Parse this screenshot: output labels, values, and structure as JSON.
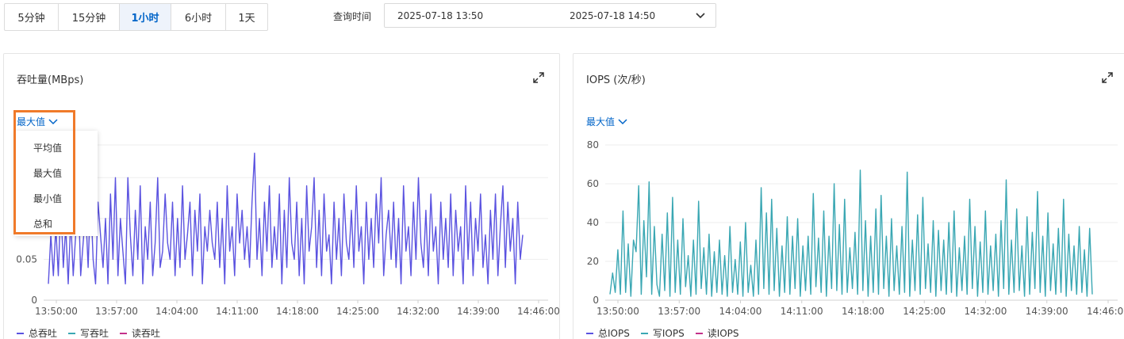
{
  "toolbar": {
    "ranges": [
      "5分钟",
      "15分钟",
      "1小时",
      "6小时",
      "1天"
    ],
    "active_index": 2
  },
  "query_time": {
    "label": "查询时间",
    "start": "2025-07-18 13:50",
    "end": "2025-07-18 14:50"
  },
  "colors": {
    "accent": "#0064c8",
    "throughput_line": "#5b53e0",
    "iops_line": "#3aa7b3",
    "legend_total": "#5b53e0",
    "legend_write": "#3aa7b3",
    "legend_read": "#c4318a",
    "highlight": "#f07a2a"
  },
  "throughput_panel": {
    "title": "吞吐量(MBps)",
    "aggregation": {
      "selected": "最大值",
      "options": [
        "平均值",
        "最大值",
        "最小值",
        "总和"
      ]
    },
    "legend": [
      "总吞吐",
      "写吞吐",
      "读吞吐"
    ]
  },
  "iops_panel": {
    "title": "IOPS (次/秒)",
    "aggregation": {
      "selected": "最大值"
    },
    "legend": [
      "总IOPS",
      "写IOPS",
      "读IOPS"
    ]
  },
  "chart_data": [
    {
      "type": "line",
      "title": "吞吐量(MBps)",
      "x_ticks": [
        "13:50:00",
        "13:57:00",
        "14:04:00",
        "14:11:00",
        "14:18:00",
        "14:25:00",
        "14:32:00",
        "14:39:00",
        "14:46:00"
      ],
      "y_ticks_visible": [
        "0.05",
        "0"
      ],
      "ylim": [
        0,
        0.19
      ],
      "series": [
        {
          "name": "总吞吐",
          "values": [
            0.02,
            0.08,
            0.03,
            0.09,
            0.03,
            0.12,
            0.04,
            0.09,
            0.02,
            0.1,
            0.03,
            0.08,
            0.14,
            0.03,
            0.07,
            0.11,
            0.04,
            0.13,
            0.05,
            0.02,
            0.12,
            0.08,
            0.04,
            0.1,
            0.02,
            0.13,
            0.05,
            0.15,
            0.03,
            0.1,
            0.06,
            0.02,
            0.15,
            0.08,
            0.03,
            0.11,
            0.05,
            0.14,
            0.02,
            0.09,
            0.05,
            0.12,
            0.03,
            0.07,
            0.15,
            0.04,
            0.06,
            0.13,
            0.07,
            0.05,
            0.12,
            0.03,
            0.1,
            0.04,
            0.14,
            0.05,
            0.08,
            0.12,
            0.03,
            0.11,
            0.06,
            0.13,
            0.02,
            0.09,
            0.06,
            0.11,
            0.07,
            0.05,
            0.12,
            0.04,
            0.1,
            0.02,
            0.14,
            0.06,
            0.09,
            0.03,
            0.13,
            0.07,
            0.11,
            0.05,
            0.09,
            0.04,
            0.12,
            0.18,
            0.05,
            0.1,
            0.03,
            0.12,
            0.06,
            0.14,
            0.04,
            0.09,
            0.05,
            0.13,
            0.02,
            0.11,
            0.04,
            0.15,
            0.07,
            0.05,
            0.12,
            0.03,
            0.1,
            0.02,
            0.14,
            0.06,
            0.09,
            0.15,
            0.04,
            0.11,
            0.03,
            0.13,
            0.06,
            0.08,
            0.02,
            0.12,
            0.05,
            0.1,
            0.03,
            0.13,
            0.07,
            0.05,
            0.11,
            0.04,
            0.14,
            0.06,
            0.09,
            0.02,
            0.12,
            0.05,
            0.1,
            0.04,
            0.13,
            0.07,
            0.15,
            0.03,
            0.08,
            0.11,
            0.05,
            0.12,
            0.04,
            0.1,
            0.02,
            0.14,
            0.06,
            0.09,
            0.03,
            0.12,
            0.05,
            0.15,
            0.07,
            0.04,
            0.11,
            0.03,
            0.13,
            0.06,
            0.09,
            0.02,
            0.12,
            0.05,
            0.1,
            0.04,
            0.13,
            0.03,
            0.11,
            0.06,
            0.09,
            0.02,
            0.14,
            0.05,
            0.12,
            0.03,
            0.1,
            0.06,
            0.13,
            0.04,
            0.08,
            0.02,
            0.11,
            0.05,
            0.13,
            0.03,
            0.09,
            0.14,
            0.04,
            0.12,
            0.06,
            0.1,
            0.02,
            0.12,
            0.05,
            0.08
          ]
        },
        {
          "name": "写吞吐",
          "values": []
        },
        {
          "name": "读吞吐",
          "values": []
        }
      ]
    },
    {
      "type": "line",
      "title": "IOPS (次/秒)",
      "x_ticks": [
        "13:50:00",
        "13:57:00",
        "14:04:00",
        "14:11:00",
        "14:18:00",
        "14:25:00",
        "14:32:00",
        "14:39:00",
        "14:46:00"
      ],
      "y_ticks": [
        "0",
        "20",
        "40",
        "60",
        "80"
      ],
      "ylim": [
        0,
        80
      ],
      "series": [
        {
          "name": "总IOPS",
          "values": [
            3,
            14,
            4,
            26,
            3,
            46,
            4,
            29,
            2,
            31,
            25,
            59,
            3,
            41,
            12,
            61,
            3,
            38,
            8,
            2,
            34,
            5,
            45,
            2,
            53,
            4,
            31,
            3,
            42,
            7,
            23,
            2,
            31,
            3,
            51,
            6,
            27,
            3,
            34,
            2,
            25,
            4,
            31,
            3,
            23,
            2,
            38,
            4,
            21,
            3,
            30,
            2,
            40,
            4,
            18,
            2,
            31,
            3,
            58,
            6,
            45,
            3,
            52,
            5,
            37,
            2,
            28,
            4,
            43,
            3,
            33,
            6,
            42,
            2,
            28,
            5,
            33,
            3,
            55,
            7,
            32,
            4,
            46,
            2,
            33,
            6,
            60,
            5,
            39,
            3,
            52,
            4,
            27,
            6,
            35,
            3,
            67,
            5,
            41,
            2,
            33,
            4,
            47,
            3,
            54,
            6,
            33,
            2,
            42,
            5,
            28,
            3,
            38,
            4,
            66,
            2,
            31,
            5,
            44,
            3,
            53,
            6,
            29,
            4,
            41,
            2,
            36,
            5,
            31,
            3,
            40,
            4,
            46,
            2,
            27,
            5,
            33,
            3,
            52,
            6,
            38,
            2,
            30,
            4,
            46,
            3,
            28,
            5,
            34,
            2,
            41,
            6,
            62,
            3,
            31,
            4,
            47,
            5,
            28,
            2,
            43,
            3,
            35,
            6,
            56,
            4,
            33,
            2,
            45,
            5,
            29,
            3,
            37,
            4,
            52,
            2,
            34,
            5,
            28,
            3,
            38,
            4,
            26,
            2,
            37,
            3
          ]
        },
        {
          "name": "写IOPS",
          "values": []
        },
        {
          "name": "读IOPS",
          "values": []
        }
      ]
    }
  ]
}
